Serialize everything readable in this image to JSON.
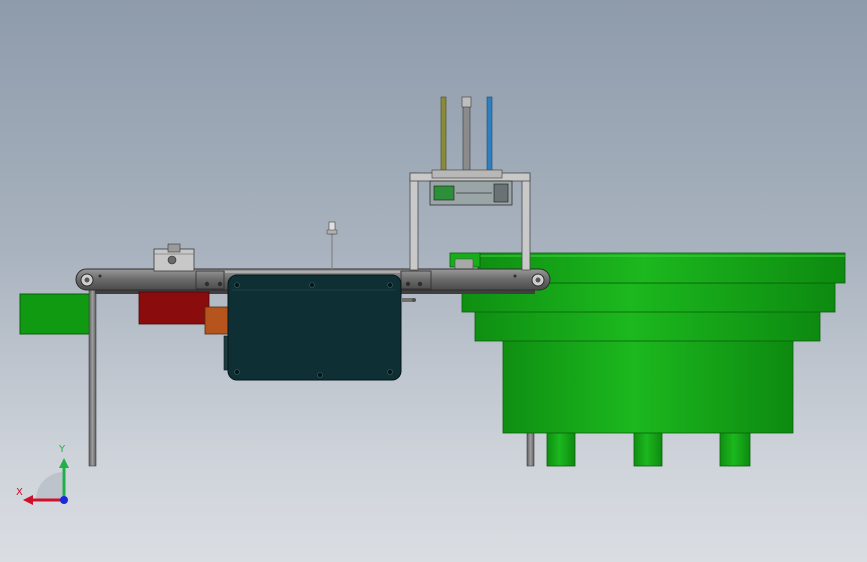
{
  "triad": {
    "x_label": "X",
    "y_label": "Y",
    "x_color": "#d0102a",
    "y_color": "#1fb04a",
    "z_color": "#1a2ad8"
  },
  "colors": {
    "part_green": "#0d9a10",
    "part_green_light": "#22c022",
    "part_green_dark": "#087a0a",
    "frame_gray": "#8e8e8e",
    "conveyor_gray": "#6d6d6d",
    "motor_teal": "#0e2f33",
    "block_red": "#8a0c0c",
    "block_orange": "#b5541c",
    "rod_olive": "#8a8a3a",
    "rod_blue": "#2e7fc0"
  }
}
